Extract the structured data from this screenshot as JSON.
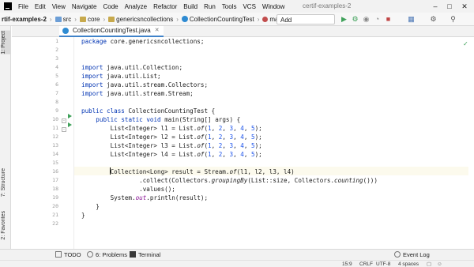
{
  "menubar": {
    "items": [
      "File",
      "Edit",
      "View",
      "Navigate",
      "Code",
      "Analyze",
      "Refactor",
      "Build",
      "Run",
      "Tools",
      "VCS",
      "Window"
    ],
    "window_title": "certif-examples-2"
  },
  "navbar": {
    "project": "rtif-examples-2",
    "crumbs": [
      "src",
      "core",
      "genericsncollections",
      "CollectionCountingTest"
    ],
    "branch": "main",
    "run_config": "Add Configuration..."
  },
  "left_tabs": {
    "project": "1: Project",
    "structure": "7: Structure",
    "favorites": "2: Favorites"
  },
  "editor_tab": {
    "label": "CollectionCountingTest.java"
  },
  "code": {
    "line_numbers": [
      "1",
      "2",
      "3",
      "4",
      "5",
      "6",
      "7",
      "8",
      "9",
      "10",
      "11",
      "12",
      "13",
      "14",
      "15",
      "16",
      "17",
      "18",
      "19",
      "20",
      "21",
      "22"
    ],
    "current_line": "15",
    "lines": [
      "package core.genericsncollections;",
      "",
      "",
      "import java.util.Collection;",
      "import java.util.List;",
      "import java.util.stream.Collectors;",
      "import java.util.stream.Stream;",
      "",
      "public class CollectionCountingTest {",
      "    public static void main(String[] args) {",
      "        List<Integer> l1 = List.of(1, 2, 3, 4, 5);",
      "        List<Integer> l2 = List.of(1, 2, 3, 4, 5);",
      "        List<Integer> l3 = List.of(1, 2, 3, 4, 5);",
      "        List<Integer> l4 = List.of(1, 2, 3, 4, 5);",
      "",
      "        Collection<Long> result = Stream.of(l1, l2, l3, l4)",
      "                .collect(Collectors.groupingBy(List::size, Collectors.counting()))",
      "                .values();",
      "        System.out.println(result);",
      "    }",
      "}",
      ""
    ]
  },
  "bottom_tools": {
    "todo": "TODO",
    "problems": "6: Problems",
    "terminal": "Terminal",
    "event_log": "Event Log"
  },
  "status": {
    "position": "15:9",
    "line_sep": "CRLF",
    "encoding": "UTF-8",
    "indent": "4 spaces"
  }
}
